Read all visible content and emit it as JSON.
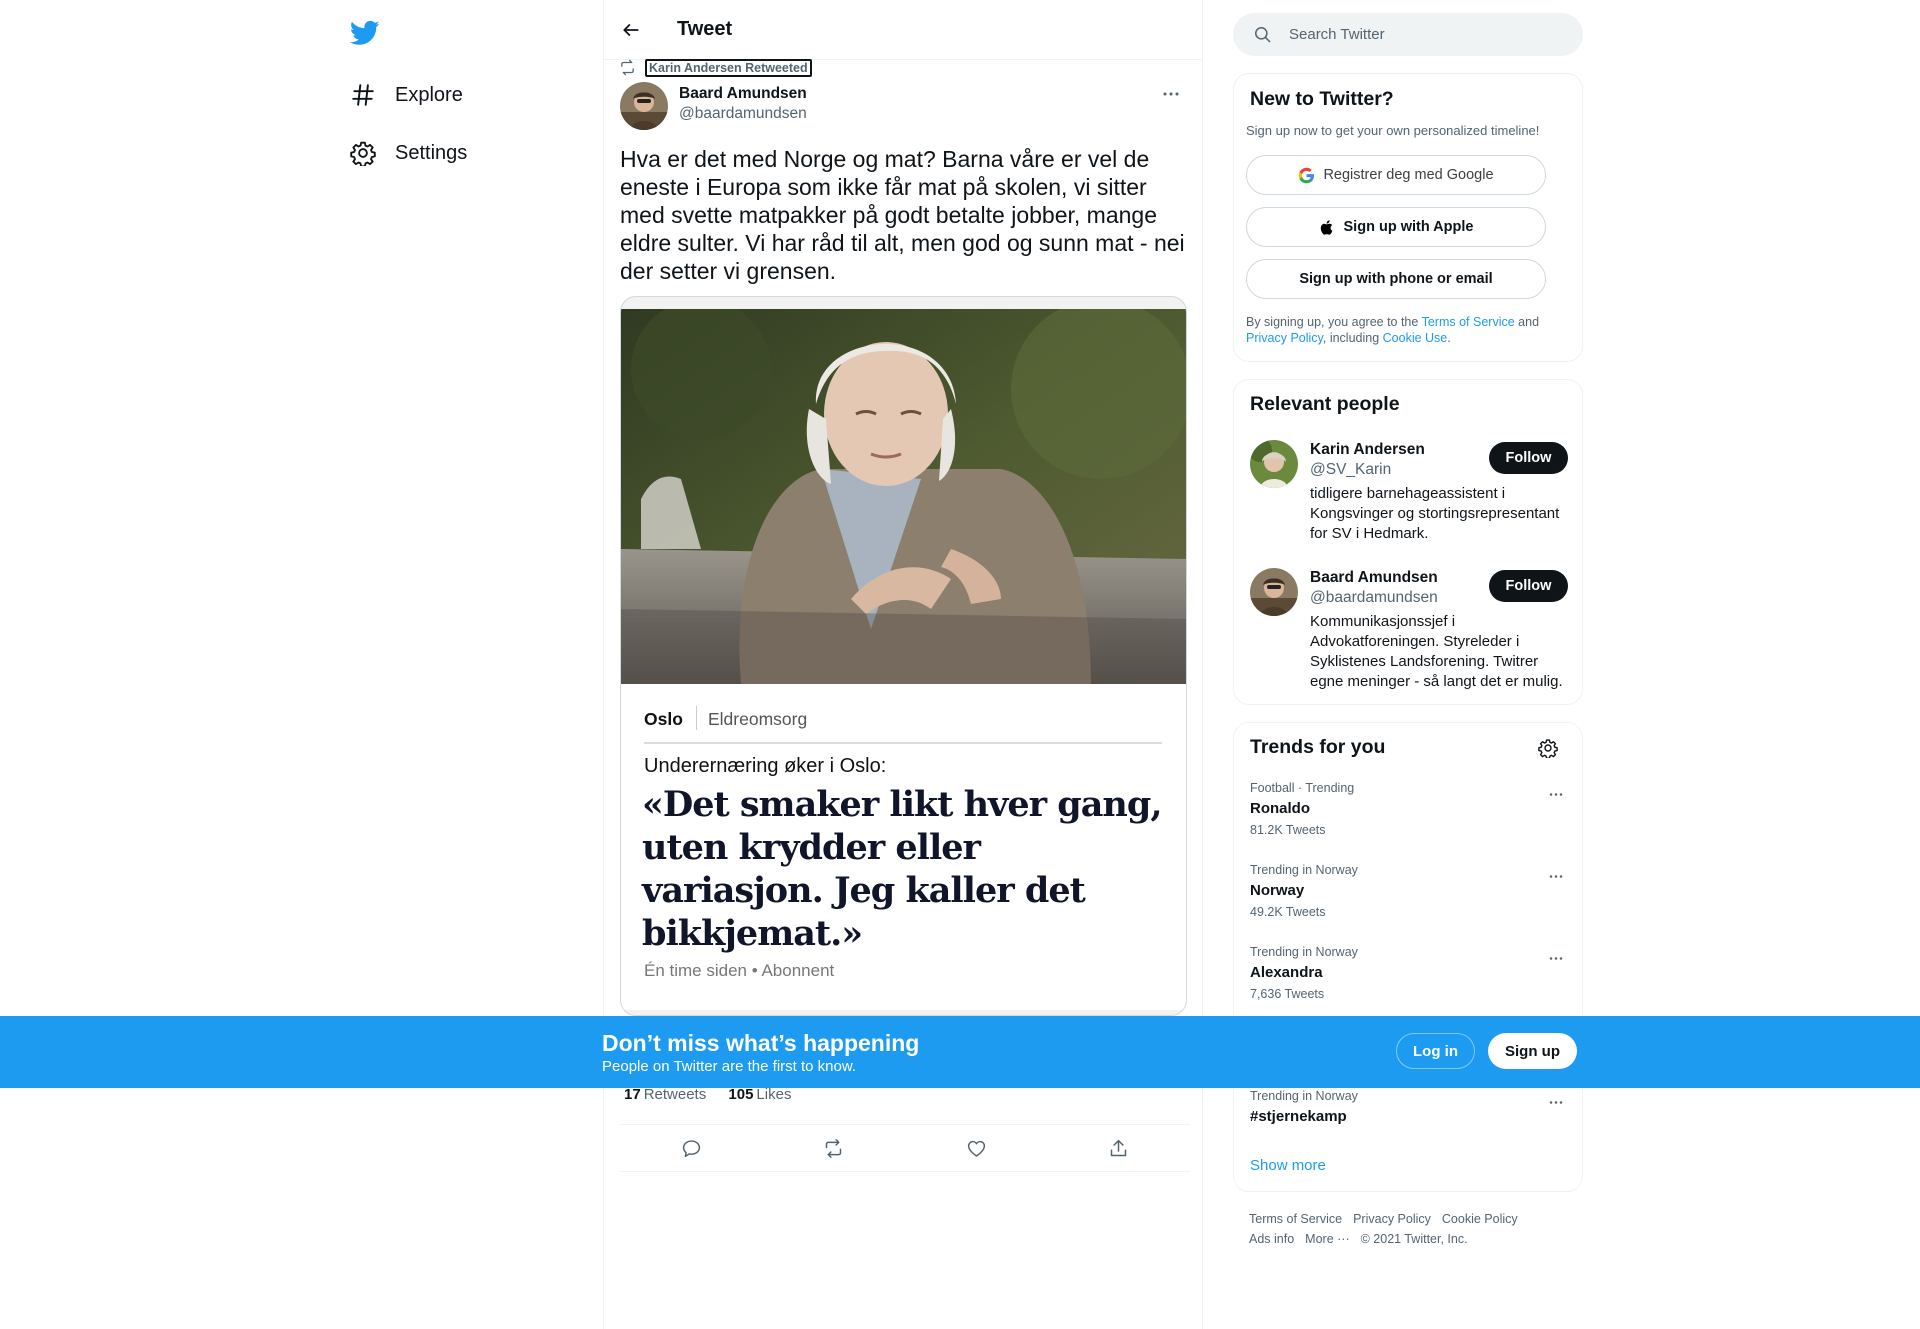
{
  "nav": {
    "logo": "twitter-bird-icon",
    "items": [
      {
        "label": "Explore",
        "icon": "hashtag-icon"
      },
      {
        "label": "Settings",
        "icon": "gear-icon"
      }
    ]
  },
  "main": {
    "title": "Tweet",
    "retweeted_by": "Karin Andersen Retweeted",
    "author": {
      "name": "Baard Amundsen",
      "handle": "@baardamundsen"
    },
    "text": "Hva er det med Norge og mat? Barna våre er vel de eneste i Europa som ikke får mat på skolen, vi sitter med svette matpakker på godt betalte jobber, mange eldre sulter. Vi har råd til alt, men god og sunn mat - nei der setter vi grensen.",
    "card": {
      "city": "Oslo",
      "category": "Eldreomsorg",
      "subtitle": "Underernæring øker i Oslo:",
      "headline": "«Det smaker likt hver gang, uten krydder eller variasjon. Jeg kaller det bikkjemat.»",
      "meta": "Én time siden • Abonnent"
    },
    "stats": {
      "retweets": "17",
      "retweets_label": "Retweets",
      "likes": "105",
      "likes_label": "Likes"
    }
  },
  "sidebar": {
    "search_placeholder": "Search Twitter",
    "new_to_twitter": {
      "title": "New to Twitter?",
      "subtitle": "Sign up now to get your own personalized timeline!",
      "google": "Registrer deg med Google",
      "apple": "Sign up with Apple",
      "phone": "Sign up with phone or email",
      "terms_1": "By signing up, you agree to the ",
      "terms_tos": "Terms of Service",
      "terms_2": " and ",
      "terms_pp": "Privacy Policy",
      "terms_3": ", including ",
      "terms_cookie": "Cookie Use",
      "terms_4": "."
    },
    "relevant": {
      "title": "Relevant people",
      "follow_label": "Follow",
      "people": [
        {
          "name": "Karin Andersen",
          "handle": "@SV_Karin",
          "bio": "tidligere barnehageassistent i Kongsvinger og stortingsrepresentant for SV i Hedmark."
        },
        {
          "name": "Baard Amundsen",
          "handle": "@baardamundsen",
          "bio": "Kommunikasjonssjef i Advokatforeningen. Styreleder i Syklistenes Landsforening. Twitrer egne meninger - så langt det er mulig."
        }
      ]
    },
    "trends": {
      "title": "Trends for you",
      "items": [
        {
          "meta": "Football · Trending",
          "name": "Ronaldo",
          "count": "81.2K Tweets"
        },
        {
          "meta": "Trending in Norway",
          "name": "Norway",
          "count": "49.2K Tweets"
        },
        {
          "meta": "Trending in Norway",
          "name": "Alexandra",
          "count": "7,636 Tweets"
        },
        {
          "meta": "Trending in Norway",
          "name": "#stjernekamp",
          "count": ""
        }
      ],
      "show_more": "Show more"
    },
    "footer": [
      "Terms of Service",
      "Privacy Policy",
      "Cookie Policy",
      "Ads info",
      "More ···",
      "© 2021 Twitter, Inc."
    ]
  },
  "banner": {
    "title": "Don’t miss what’s happening",
    "subtitle": "People on Twitter are the first to know.",
    "login": "Log in",
    "signup": "Sign up"
  },
  "colors": {
    "accent": "#1d9bf0",
    "text": "#0f1419",
    "secondary": "#536471",
    "border": "#eff3f4"
  }
}
